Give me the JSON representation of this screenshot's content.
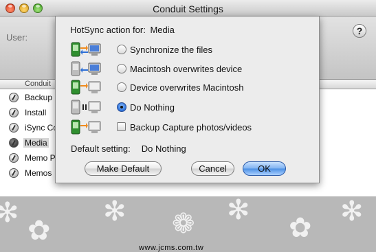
{
  "window": {
    "title": "Conduit Settings",
    "user_label": "User:",
    "help_label": "?"
  },
  "conduit_list": {
    "header": "Conduit",
    "rows": [
      {
        "label": "Backup"
      },
      {
        "label": "Install"
      },
      {
        "label": "iSync Co"
      },
      {
        "label": "Media",
        "selected": true
      },
      {
        "label": "Memo Pa"
      },
      {
        "label": "Memos"
      }
    ]
  },
  "sheet": {
    "heading_prefix": "HotSync action for:",
    "heading_target": "Media",
    "options": [
      {
        "label": "Synchronize the files",
        "control": "radio",
        "checked": false,
        "icon": "sync-both-icon"
      },
      {
        "label": "Macintosh overwrites device",
        "control": "radio",
        "checked": false,
        "icon": "mac-to-device-icon"
      },
      {
        "label": "Device overwrites Macintosh",
        "control": "radio",
        "checked": false,
        "icon": "device-to-mac-icon"
      },
      {
        "label": "Do Nothing",
        "control": "radio",
        "checked": true,
        "icon": "do-nothing-icon"
      },
      {
        "label": "Backup Capture photos/videos",
        "control": "checkbox",
        "checked": false,
        "icon": "device-to-mac-icon"
      }
    ],
    "default_label": "Default setting:",
    "default_value": "Do Nothing",
    "buttons": {
      "make_default": "Make Default",
      "cancel": "Cancel",
      "ok": "OK"
    }
  },
  "watermark": "www.jcms.com.tw",
  "colors": {
    "accent_blue": "#4b8fe4",
    "arrow_orange": "#f08a1c",
    "arrow_blue": "#2d6fd6",
    "device_green": "#2f8f2f"
  }
}
